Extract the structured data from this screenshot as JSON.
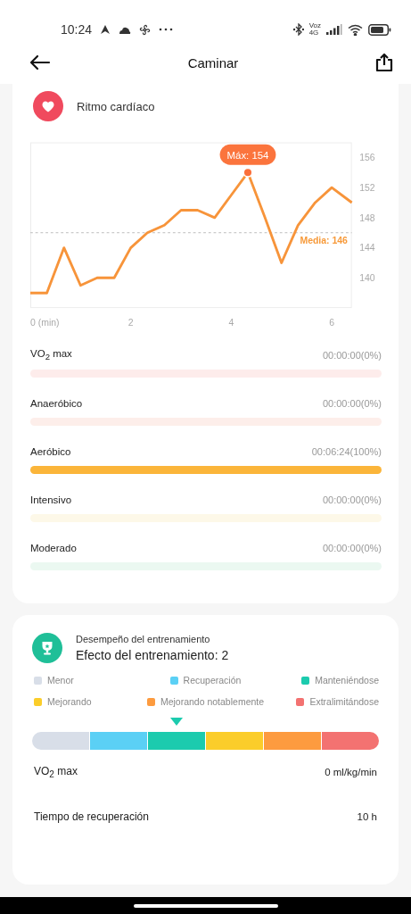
{
  "status_bar": {
    "time": "10:24",
    "network_label": "Voz",
    "network_type": "4G"
  },
  "header": {
    "title": "Caminar"
  },
  "heart_rate": {
    "title": "Ritmo cardíaco",
    "max_label": "Máx: 154",
    "chart_data": {
      "type": "line",
      "x": [
        0,
        0.33,
        0.67,
        1,
        1.33,
        1.67,
        2,
        2.33,
        2.67,
        3,
        3.33,
        3.67,
        4,
        4.33,
        4.67,
        5,
        5.33,
        5.67,
        6,
        6.4
      ],
      "series": [
        {
          "color": "#f7943a",
          "values": [
            138,
            138,
            144,
            139,
            140,
            140,
            144,
            146,
            147,
            149,
            149,
            148,
            151,
            154,
            148,
            142,
            147,
            150,
            152,
            150
          ]
        }
      ],
      "xlim": [
        0,
        6.4
      ],
      "ylim": [
        136,
        158
      ],
      "xticks": [
        {
          "value": 0,
          "label": "0 (min)"
        },
        2,
        4,
        6
      ],
      "yticks": [
        140,
        144,
        148,
        152,
        156
      ],
      "ref_lines": [
        {
          "axis": "y",
          "value": 146,
          "label": "Media: 146"
        }
      ]
    },
    "zones": [
      {
        "name": "VO$_{2}$ max",
        "value": "00:00:00(0%)",
        "color": "#fdeceb"
      },
      {
        "name": "Anaeróbico",
        "value": "00:00:00(0%)",
        "color": "#fdeeea"
      },
      {
        "name": "Aeróbico",
        "value": "00:06:24(100%)",
        "color": "#fbb53a"
      },
      {
        "name": "Intensivo",
        "value": "00:00:00(0%)",
        "color": "#fdf8e8"
      },
      {
        "name": "Moderado",
        "value": "00:00:00(0%)",
        "color": "#ebf8f1"
      }
    ]
  },
  "training": {
    "subtitle": "Desempeño del entrenamiento",
    "title": "Efecto del entrenamiento: 2",
    "levels": [
      {
        "label": "Menor",
        "color": "#d8dee8",
        "selected": false
      },
      {
        "label": "Recuperación",
        "color": "#5bd0f5",
        "selected": false
      },
      {
        "label": "Manteniéndose",
        "color": "#1ccbae",
        "selected": true
      },
      {
        "label": "Mejorando",
        "color": "#fbcd2a",
        "selected": false
      },
      {
        "label": "Mejorando notablemente",
        "color": "#fd9b3f",
        "selected": false
      },
      {
        "label": "Extralimitándose",
        "color": "#f37271",
        "selected": false
      }
    ],
    "metrics": [
      {
        "label": "VO$_{2}$ max",
        "value": "0 ml/kg/min"
      },
      {
        "label": "Tiempo de recuperación",
        "value": "10 h"
      }
    ]
  }
}
